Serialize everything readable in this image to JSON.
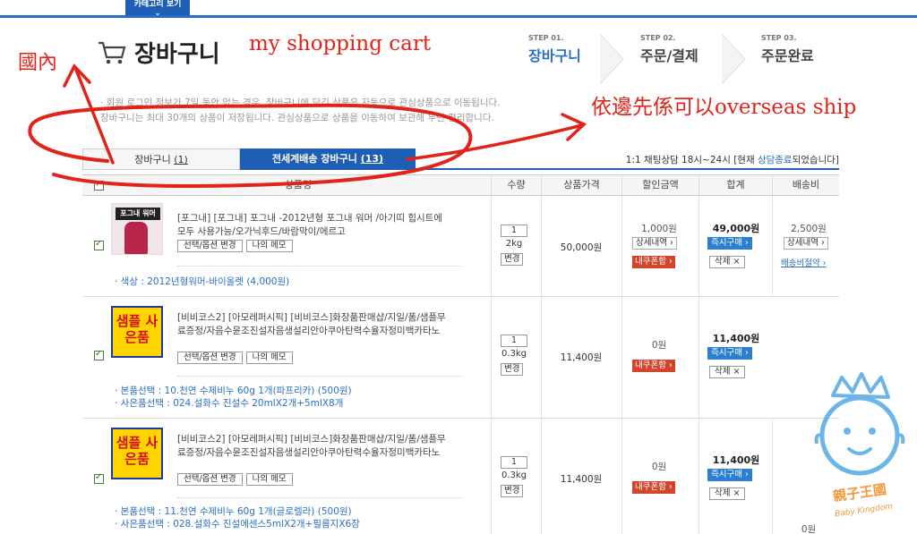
{
  "top": {
    "category_tab": "카테고리 보기"
  },
  "header": {
    "title": "장바구니"
  },
  "steps": [
    {
      "num": "STEP 01.",
      "label": "장바구니"
    },
    {
      "num": "STEP 02.",
      "label": "주문/결제"
    },
    {
      "num": "STEP 03.",
      "label": "주문완료"
    }
  ],
  "notice": {
    "line1": "· 회원 로그인 정보가 7일 동안 없는 경우, 장바구니에 담긴 상품은 자동으로 관심상품으로 이동됩니다.",
    "line2": "장바구니는 최대 30개의 상품이 저장됩니다. 관심상품으로 상품을 이동하여 보관해 두면 편리합니다."
  },
  "tabs": {
    "tab1": {
      "label": "장바구니",
      "count": "(1)"
    },
    "tab2": {
      "label": "전세계배송 장바구니",
      "count": "(13)"
    }
  },
  "chat": {
    "prefix": "1:1 채팅상담 18시~24시 [현재 ",
    "status": "상담종료",
    "suffix": "되었습니다]"
  },
  "table": {
    "headers": [
      "상품명",
      "수량",
      "상품가격",
      "할인금액",
      "합계",
      "배송비"
    ]
  },
  "rows": [
    {
      "name": "[포그내] [포그내] 포그내 -2012년형 포그내 워머 /아기띠 힙시트에 모두 사용가능/오가닉후드/바람막이/에르고",
      "thumb_text": "포그내 워머",
      "btn_option": "선택/옵션 변경",
      "btn_memo": "나의 메모",
      "options": [
        "· 색상 : 2012년형워머-바이올렛 (4,000원)"
      ],
      "qty": "1",
      "weight": "2kg",
      "change": "변경",
      "price": "50,000원",
      "discount": "1,000원",
      "discount_detail": "상세내역",
      "coupon": "내쿠폰함",
      "total": "49,000원",
      "buy": "즉시구매",
      "delete": "삭제 ×",
      "ship": "2,500원",
      "ship_detail": "상세내역",
      "ship_center": "배송비절약"
    },
    {
      "name": "[비비코스2] [아모레퍼시픽] [비비코스]화장품판매샵/지일/폼/샘플무료증정/자음수윤조진설자음생설리안아쿠아탄력수율자정미백카타노",
      "thumb_text": "샘플 사은품",
      "btn_option": "선택/옵션 변경",
      "btn_memo": "나의 메모",
      "options": [
        "· 본품선택 : 10.천연 수제비누 60g 1개(파프리카) (500원)",
        "· 사은품선택 : 024.설화수 진설수 20mlX2개+5mlX8개"
      ],
      "qty": "1",
      "weight": "0.3kg",
      "change": "변경",
      "price": "11,400원",
      "discount": "0원",
      "coupon": "내쿠폰함",
      "total": "11,400원",
      "buy": "즉시구매",
      "delete": "삭제 ×"
    },
    {
      "name": "[비비코스2] [아모레퍼시픽] [비비코스]화장품판매샵/지일/폼/샘플무료증정/자음수윤조진설자음생설리안아쿠아탄력수율자정미백카타노",
      "thumb_text": "샘플 사은품",
      "btn_option": "선택/옵션 변경",
      "btn_memo": "나의 메모",
      "options": [
        "· 본품선택 : 11.천연 수제비누 60g 1개(글로렐라) (500원)",
        "· 사은품선택 : 028.설화수 진설에센스5mlX2개+필름지X6장"
      ],
      "qty": "1",
      "weight": "0.3kg",
      "change": "변경",
      "price": "11,400원",
      "discount": "0원",
      "coupon": "내쿠폰함",
      "total": "11,400원",
      "buy": "즉시구매",
      "delete": "삭제 ×",
      "ship": "0원"
    }
  ],
  "annotations": {
    "a": "my shopping cart",
    "b": "國內",
    "c": "依邊先係可以overseas ship"
  },
  "watermark": {
    "cn": "親子王國",
    "en": "Baby Kingdom"
  },
  "colors": {
    "accent": "#1e5fb5",
    "annotation": "#e2231a",
    "coupon": "#d2452b"
  }
}
